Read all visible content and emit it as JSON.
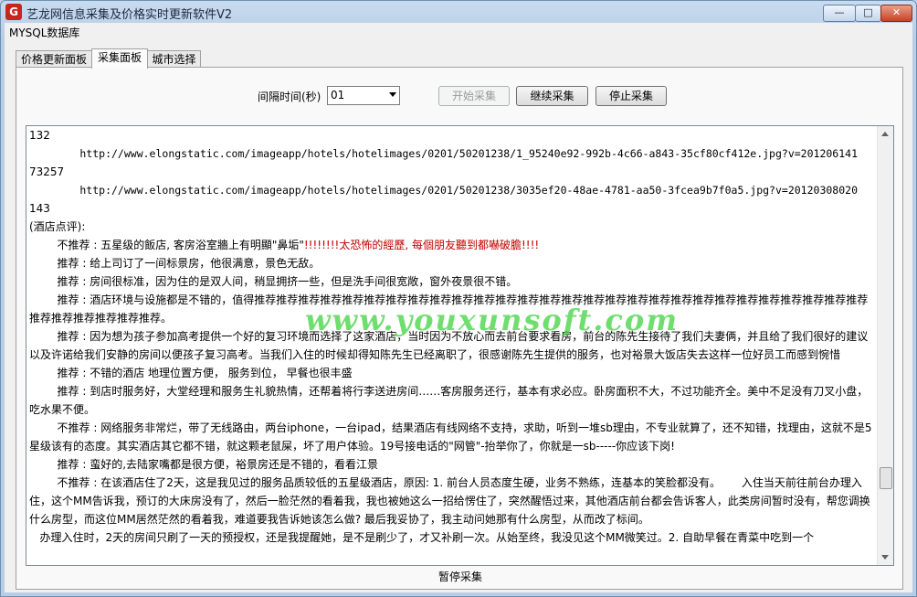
{
  "window": {
    "title": "艺龙网信息采集及价格实时更新软件V2",
    "icon_letter": "G",
    "minimize": "—",
    "restore": "□",
    "close": "✕"
  },
  "menubar": {
    "item": "MYSQL数据库"
  },
  "tabs": [
    {
      "label": "价格更新面板",
      "active": false
    },
    {
      "label": "采集面板",
      "active": true
    },
    {
      "label": "城市选择",
      "active": false
    }
  ],
  "controls": {
    "interval_label": "间隔时间(秒)",
    "interval_value": "01",
    "start_button": "开始采集",
    "continue_button": "继续采集",
    "stop_button": "停止采集"
  },
  "log": {
    "l0": "132",
    "l1": "        http://www.elongstatic.com/imageapp/hotels/hotelimages/0201/50201238/1_95240e92-992b-4c66-a843-35cf80cf412e.jpg?v=201206141",
    "l2": "73257",
    "l3": "        http://www.elongstatic.com/imageapp/hotels/hotelimages/0201/50201238/3035ef20-48ae-4781-aa50-3fcea9b7f0a5.jpg?v=20120308020",
    "l4": "143",
    "l5": "(酒店点评):",
    "l6a": "        不推荐 : 五星级的飯店, 客房浴室牆上有明顯\"鼻垢\"",
    "l6b": "!!!!!!!!太恐怖的經歷, 每個朋友聽到都嚇破膽!!!!",
    "l7": "        推荐 : 给上司订了一间标景房，他很满意，景色无敌。",
    "l8": "        推荐 : 房间很标准，因为住的是双人间，稍显拥挤一些，但是洗手间很宽敞，窗外夜景很不错。",
    "l9": "        推荐 : 酒店环境与设施都是不错的，值得推荐推荐推荐推荐推荐推荐推荐推荐推荐推荐推荐推荐推荐推荐推荐推荐推荐推荐推荐推荐推荐推荐推荐推荐推荐推荐推荐推荐推荐推荐推荐推荐推荐推荐。",
    "l10": "        推荐 : 因为想为孩子参加高考提供一个好的复习环境而选择了这家酒店，当时因为不放心而去前台要求看房，前台的陈先生接待了我们夫妻俩，并且给了我们很好的建议以及许诺给我们安静的房间以便孩子复习高考。当我们入住的时候却得知陈先生已经离职了，很感谢陈先生提供的服务，也对裕景大饭店失去这样一位好员工而感到惋惜",
    "l11": "        推荐 : 不错的酒店 地理位置方便， 服务到位， 早餐也很丰盛",
    "l12": "        推荐 : 到店时服务好，大堂经理和服务生礼貌热情，还帮着将行李送进房间……客房服务还行，基本有求必应。卧房面积不大，不过功能齐全。美中不足没有刀叉小盘，吃水果不便。",
    "l13": "        不推荐 : 网络服务非常烂，带了无线路由，两台iphone，一台ipad，结果酒店有线网络不支持，求助，听到一堆sb理由，不专业就算了，还不知错，找理由，这就不是5星级该有的态度。其实酒店其它都不错，就这颗老鼠屎，坏了用户体验。19号接电话的\"网管\"-抬举你了，你就是一sb-----你应该下岗!",
    "l14": "        推荐 : 蛮好的,去陆家嘴都是很方便，裕景房还是不错的，看看江景",
    "l15": "        不推荐 : 在该酒店住了2天，这是我见过的服务品质较低的五星级酒店，原因: 1. 前台人员态度生硬，业务不熟练，连基本的笑脸都没有。      入住当天前往前台办理入住，这个MM告诉我，预订的大床房没有了，然后一脸茫然的看着我，我也被她这么一招给愣住了，突然醒悟过来，其他酒店前台都会告诉客人，此类房间暂时没有，帮您调换什么房型，而这位MM居然茫然的看着我，难道要我告诉她该怎么做? 最后我妥协了，我主动问她那有什么房型，从而改了标间。",
    "l16": "   办理入住时，2天的房间只刷了一天的预授权，还是我提醒她，是不是刷少了，才又补刷一次。从始至终，我没见这个MM微笑过。2. 自助早餐在青菜中吃到一个"
  },
  "watermark": "www.youxunsoft.com",
  "status": "暂停采集"
}
